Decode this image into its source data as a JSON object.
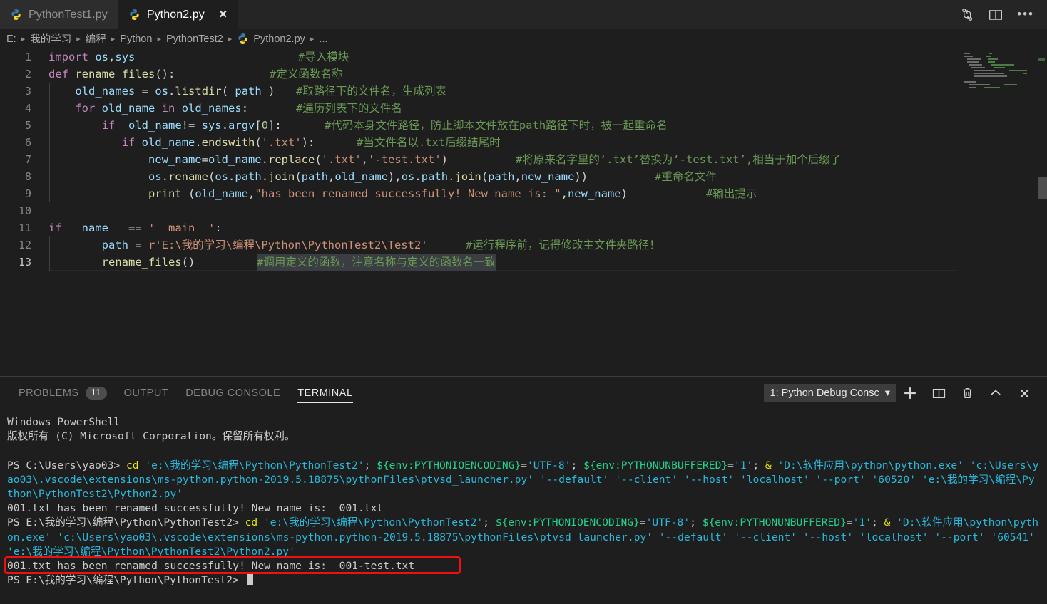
{
  "window": {
    "tabs": [
      {
        "label": "PythonTest1.py",
        "icon": "python-file-icon",
        "active": false,
        "closable": false
      },
      {
        "label": "Python2.py",
        "icon": "python-file-icon",
        "active": true,
        "closable": true,
        "close_label": "✕"
      }
    ],
    "tab_actions": [
      {
        "name": "split-editor-vertical-icon",
        "label": "split"
      },
      {
        "name": "split-editor-layout-icon",
        "label": "layout"
      },
      {
        "name": "more-actions-icon",
        "label": "•••"
      }
    ]
  },
  "breadcrumb": {
    "separator": "▸",
    "items": [
      "E:",
      "我的学习",
      "编程",
      "Python",
      "PythonTest2",
      "Python2.py",
      "..."
    ]
  },
  "editor": {
    "language": "python",
    "current_line": 13,
    "line_numbers": [
      "1",
      "2",
      "3",
      "4",
      "5",
      "6",
      "7",
      "8",
      "9",
      "10",
      "11",
      "12",
      "13"
    ],
    "lines": [
      {
        "n": 1,
        "code": "import os,sys",
        "comment": "#导入模块"
      },
      {
        "n": 2,
        "code": "def rename_files():",
        "comment": "#定义函数名称"
      },
      {
        "n": 3,
        "code": "    old_names = os.listdir( path )",
        "comment": "#取路径下的文件名，生成列表"
      },
      {
        "n": 4,
        "code": "    for old_name in old_names:",
        "comment": "#遍历列表下的文件名"
      },
      {
        "n": 5,
        "code": "        if  old_name!= sys.argv[0]:",
        "comment": "#代码本身文件路径，防止脚本文件放在path路径下时，被一起重命名"
      },
      {
        "n": 6,
        "code": "           if old_name.endswith('.txt'):",
        "comment": "#当文件名以.txt后缀结尾时"
      },
      {
        "n": 7,
        "code": "               new_name=old_name.replace('.txt','-test.txt')",
        "comment": "#将原来名字里的‘.txt’替换为‘-test.txt’,相当于加个后缀了"
      },
      {
        "n": 8,
        "code": "               os.rename(os.path.join(path,old_name),os.path.join(path,new_name))",
        "comment": "#重命名文件"
      },
      {
        "n": 9,
        "code": "               print (old_name,\"has been renamed successfully! New name is: \",new_name)",
        "comment": "#输出提示"
      },
      {
        "n": 10,
        "code": "",
        "comment": ""
      },
      {
        "n": 11,
        "code": "if __name__ == '__main__':",
        "comment": ""
      },
      {
        "n": 12,
        "code": "        path = r'E:\\我的学习\\编程\\Python\\PythonTest2\\Test2'",
        "comment": "#运行程序前，记得修改主文件夹路径！"
      },
      {
        "n": 13,
        "code": "        rename_files()",
        "comment": "#调用定义的函数，注意名称与定义的函数名一致"
      }
    ]
  },
  "panel": {
    "tabs": [
      {
        "label": "PROBLEMS",
        "badge": "11",
        "active": false
      },
      {
        "label": "OUTPUT",
        "badge": "",
        "active": false
      },
      {
        "label": "DEBUG CONSOLE",
        "badge": "",
        "active": false
      },
      {
        "label": "TERMINAL",
        "badge": "",
        "active": true
      }
    ],
    "terminal_select": {
      "value": "1: Python Debug Consc",
      "chevron": "▾"
    },
    "actions": [
      {
        "name": "new-terminal-icon",
        "label": "+"
      },
      {
        "name": "split-terminal-icon",
        "label": "split"
      },
      {
        "name": "kill-terminal-icon",
        "label": "trash"
      },
      {
        "name": "maximize-panel-icon",
        "label": "^"
      },
      {
        "name": "close-panel-icon",
        "label": "✕"
      }
    ]
  },
  "terminal": {
    "lines": [
      [
        {
          "t": "Windows PowerShell",
          "c": "c-white"
        }
      ],
      [
        {
          "t": "版权所有 (C) Microsoft Corporation。保留所有权利。",
          "c": "c-white"
        }
      ],
      [
        {
          "t": "",
          "c": "c-white"
        }
      ],
      [
        {
          "t": "PS C:\\Users\\yao03> ",
          "c": "c-white"
        },
        {
          "t": "cd ",
          "c": "c-yellow"
        },
        {
          "t": "'e:\\我的学习\\编程\\Python\\PythonTest2'",
          "c": "c-cyan"
        },
        {
          "t": "; ",
          "c": "c-white"
        },
        {
          "t": "${env:PYTHONIOENCODING}",
          "c": "c-green"
        },
        {
          "t": "=",
          "c": "c-white"
        },
        {
          "t": "'UTF-8'",
          "c": "c-cyan"
        },
        {
          "t": "; ",
          "c": "c-white"
        },
        {
          "t": "${env:PYTHONUNBUFFERED}",
          "c": "c-green"
        },
        {
          "t": "=",
          "c": "c-white"
        },
        {
          "t": "'1'",
          "c": "c-cyan"
        },
        {
          "t": "; ",
          "c": "c-white"
        },
        {
          "t": "& ",
          "c": "c-yellow"
        },
        {
          "t": "'D:\\软件应用\\python\\python.exe' 'c:\\Users\\yao03\\.vscode\\extensions\\ms-python.python-2019.5.18875\\pythonFiles\\ptvsd_launcher.py' '--default' '--client' '--host' 'localhost' '--port' '60520' 'e:\\我的学习\\编程\\Python\\PythonTest2\\Python2.py'",
          "c": "c-cyan"
        }
      ],
      [
        {
          "t": "001.txt has been renamed successfully! New name is:  001.txt",
          "c": "c-white"
        }
      ],
      [
        {
          "t": "PS E:\\我的学习\\编程\\Python\\PythonTest2> ",
          "c": "c-white"
        },
        {
          "t": "cd ",
          "c": "c-yellow"
        },
        {
          "t": "'e:\\我的学习\\编程\\Python\\PythonTest2'",
          "c": "c-cyan"
        },
        {
          "t": "; ",
          "c": "c-white"
        },
        {
          "t": "${env:PYTHONIOENCODING}",
          "c": "c-green"
        },
        {
          "t": "=",
          "c": "c-white"
        },
        {
          "t": "'UTF-8'",
          "c": "c-cyan"
        },
        {
          "t": "; ",
          "c": "c-white"
        },
        {
          "t": "${env:PYTHONUNBUFFERED}",
          "c": "c-green"
        },
        {
          "t": "=",
          "c": "c-white"
        },
        {
          "t": "'1'",
          "c": "c-cyan"
        },
        {
          "t": "; ",
          "c": "c-white"
        },
        {
          "t": "& ",
          "c": "c-yellow"
        },
        {
          "t": "'D:\\软件应用\\python\\python.exe' 'c:\\Users\\yao03\\.vscode\\extensions\\ms-python.python-2019.5.18875\\pythonFiles\\ptvsd_launcher.py' '--default' '--client' '--host' 'localhost' '--port' '60541' 'e:\\我的学习\\编程\\Python\\PythonTest2\\Python2.py'",
          "c": "c-cyan"
        }
      ],
      [
        {
          "t": "001.txt has been renamed successfully! New name is:  001-test.txt",
          "c": "c-white"
        }
      ],
      [
        {
          "t": "PS E:\\我的学习\\编程\\Python\\PythonTest2> ",
          "c": "c-white"
        }
      ]
    ],
    "highlight_note": "red-rectangle-annotation"
  },
  "colors": {
    "background": "#1e1e1e",
    "tabbar": "#252526",
    "accent": "#007acc",
    "comment_green": "#6a9955",
    "string_orange": "#ce9178",
    "keyword_purple": "#c586c0",
    "keyword_blue": "#569cd6",
    "identifier_blue": "#9cdcfe",
    "function_yellow": "#dcdcaa",
    "annotation_red": "#f01010",
    "terminal_green": "#23d18b",
    "terminal_cyan": "#29b8db",
    "terminal_yellow": "#e5e510"
  }
}
